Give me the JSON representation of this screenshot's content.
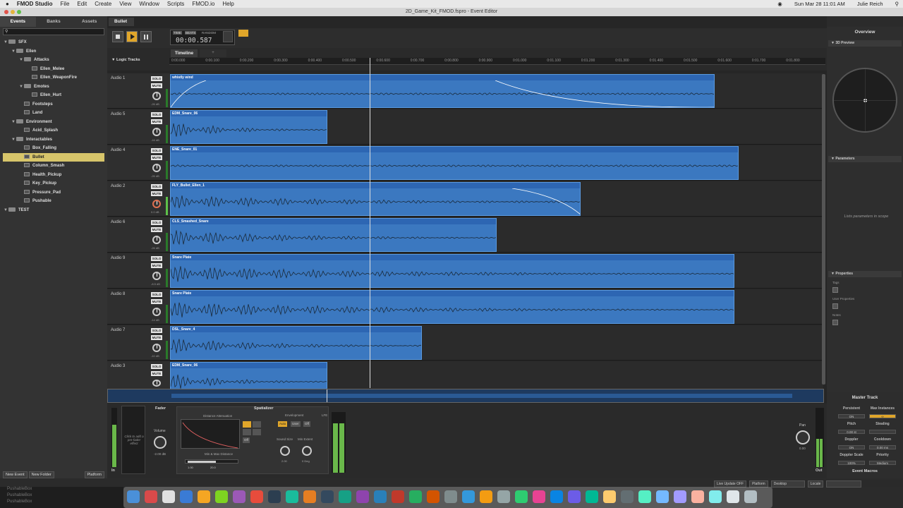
{
  "menubar": {
    "app": "FMOD Studio",
    "items": [
      "File",
      "Edit",
      "Create",
      "View",
      "Window",
      "Scripts",
      "FMOD.io",
      "Help"
    ],
    "clock": "Sun Mar 28  11:01 AM",
    "user": "Julie Reich"
  },
  "window": {
    "title": "2D_Game_Kit_FMOD.fspro - Event Editor"
  },
  "left": {
    "tabs": [
      "Events",
      "Banks",
      "Assets"
    ],
    "tree": [
      {
        "label": "SFX",
        "depth": 0,
        "type": "folder"
      },
      {
        "label": "Ellen",
        "depth": 1,
        "type": "folder"
      },
      {
        "label": "Attacks",
        "depth": 2,
        "type": "folder"
      },
      {
        "label": "Ellen_Melee",
        "depth": 3,
        "type": "event"
      },
      {
        "label": "Ellen_WeaponFire",
        "depth": 3,
        "type": "event"
      },
      {
        "label": "Emotes",
        "depth": 2,
        "type": "folder"
      },
      {
        "label": "Ellen_Hurt",
        "depth": 3,
        "type": "event"
      },
      {
        "label": "Footsteps",
        "depth": 2,
        "type": "event"
      },
      {
        "label": "Land",
        "depth": 2,
        "type": "event"
      },
      {
        "label": "Environment",
        "depth": 1,
        "type": "folder"
      },
      {
        "label": "Acid_Splash",
        "depth": 2,
        "type": "event"
      },
      {
        "label": "Interactables",
        "depth": 1,
        "type": "folder"
      },
      {
        "label": "Box_Falling",
        "depth": 2,
        "type": "event"
      },
      {
        "label": "Bullet",
        "depth": 2,
        "type": "event",
        "selected": true
      },
      {
        "label": "Column_Smash",
        "depth": 2,
        "type": "event"
      },
      {
        "label": "Health_Pickup",
        "depth": 2,
        "type": "event"
      },
      {
        "label": "Key_Pickup",
        "depth": 2,
        "type": "event"
      },
      {
        "label": "Pressure_Pad",
        "depth": 2,
        "type": "event"
      },
      {
        "label": "Pushable",
        "depth": 2,
        "type": "event"
      },
      {
        "label": "TEST",
        "depth": 0,
        "type": "folder"
      }
    ],
    "new_event": "New Event",
    "new_folder": "New Folder",
    "platform": "Platform"
  },
  "editor": {
    "event_tab": "Bullet",
    "time_modes": [
      "TIME",
      "BEATS"
    ],
    "time_random": "RANDOM",
    "time": "00:00.587",
    "logic_tracks": "Logic Tracks",
    "timeline_tab": "Timeline",
    "ruler": [
      "0:00.000",
      "0:00.100",
      "0:00.200",
      "0:00.300",
      "0:00.400",
      "0:00.500",
      "0:00.600",
      "0:00.700",
      "0:00.800",
      "0:00.900",
      "0:01.000",
      "0:01.100",
      "0:01.200",
      "0:01.300",
      "0:01.400",
      "0:01.500",
      "0:01.600",
      "0:01.700",
      "0:01.800"
    ],
    "tracks": [
      {
        "name": "Audio 1",
        "db": "-26 dB",
        "clip": "whistly wind"
      },
      {
        "name": "Audio 5",
        "db": "-16 dB",
        "clip": "EDM_Snare_06"
      },
      {
        "name": "Audio 4",
        "db": "-26 dB",
        "clip": "ENE_Snare_01"
      },
      {
        "name": "Audio 2",
        "db": "0.0 dB",
        "clip": "FLY_Bullet_Ellen_1"
      },
      {
        "name": "Audio 6",
        "db": "-26 dB",
        "clip": "CLS_Smashed_Snare"
      },
      {
        "name": "Audio 9",
        "db": "-8.5 dB",
        "clip": "Snare Plate"
      },
      {
        "name": "Audio 8",
        "db": "-14 dB",
        "clip": "Snare Plate"
      },
      {
        "name": "Audio 7",
        "db": "-10 dB",
        "clip": "DSL_Snare_4"
      },
      {
        "name": "Audio 3",
        "db": "",
        "clip": "EDM_Snare_06"
      }
    ],
    "solo": "SOLO",
    "mute": "MUTE"
  },
  "deck": {
    "fader": "Fader",
    "pre_fader_hint": "Click to add a pre-fader effect",
    "volume": "Volume",
    "volume_value": "-2.00 dB",
    "spatializer": "Spatializer",
    "distance_attenuation": "Distance Attenuation",
    "envelopment": "Envelopment",
    "env_options": [
      "Auto",
      "User",
      "Off"
    ],
    "off": "Off",
    "sound_size": "Sound Size",
    "sound_size_val": "2.00",
    "min_extent": "Min Extent",
    "min_extent_val": "0 Deg",
    "min_max_distance": "Min & Max Distance",
    "min_val": "1.00",
    "max_val": "20.0",
    "lfe": "LFE",
    "in": "In",
    "out": "Out",
    "pan": "Pan",
    "pan_val": "0.00"
  },
  "right": {
    "overview": "Overview",
    "preview_3d": "3D Preview",
    "parameters": "Parameters",
    "params_hint": "Lists parameters in scope",
    "properties": "Properties",
    "tags": "Tags",
    "user_properties": "User Properties",
    "notes": "Notes"
  },
  "master": {
    "title": "Master Track",
    "persistent": "Persistent",
    "max_instances": "Max Instances",
    "persistent_val": "ON",
    "max_val": "∞",
    "pitch": "Pitch",
    "stealing": "Stealing",
    "pitch_val": "0.00 st",
    "doppler": "Doppler",
    "cooldown": "Cooldown",
    "doppler_val": "ON",
    "cooldown_val": "0.00 ms",
    "doppler_scale": "Doppler Scale",
    "priority": "Priority",
    "doppler_scale_val": "100%",
    "priority_val": "Medium",
    "macros": "Event Macros"
  },
  "status": {
    "live_update": "Live Update OFF",
    "platform": "Platform",
    "platform_val": "Desktop",
    "locale": "Locale"
  },
  "desktop": {
    "files": [
      "PushableBox",
      "PushableBox",
      "PushableBox"
    ]
  }
}
